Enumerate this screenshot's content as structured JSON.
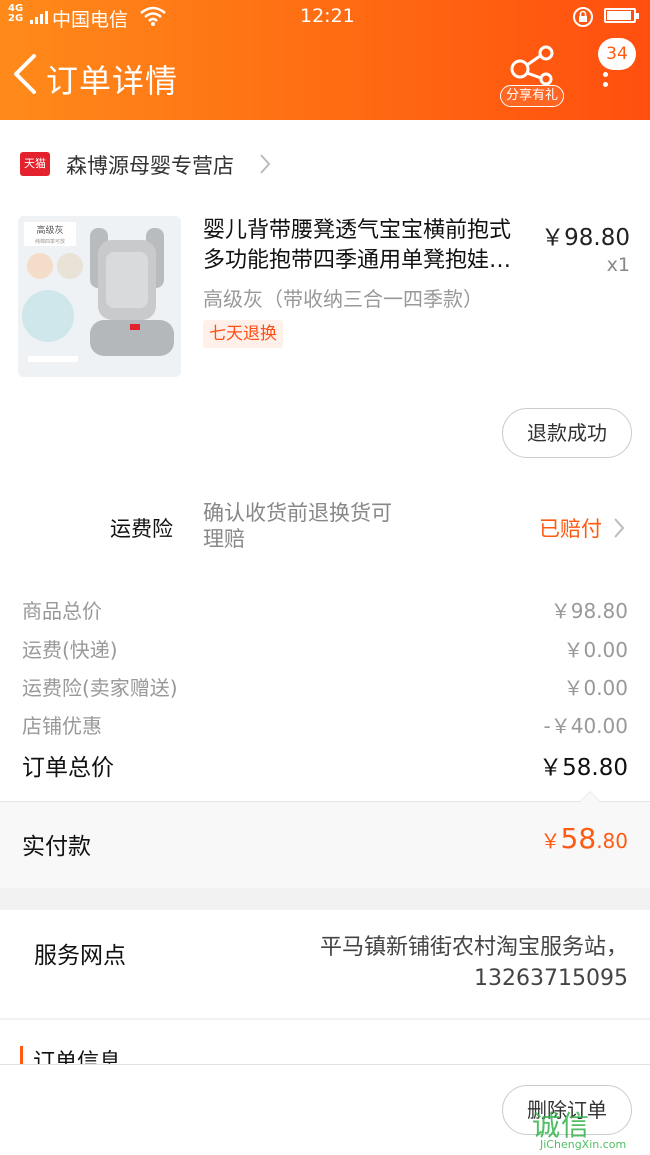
{
  "status_bar": {
    "network": "4G",
    "network2": "2G",
    "carrier": "中国电信",
    "time": "12:21"
  },
  "header": {
    "title": "订单详情",
    "share_label": "分享有礼",
    "message_badge": "34"
  },
  "shop": {
    "platform_badge": "天猫",
    "name": "森博源母婴专营店"
  },
  "product": {
    "title_line1": "婴儿背带腰凳透气宝宝横前抱式",
    "title_line2": "多功能抱带四季通用单凳抱娃…",
    "price": "￥98.80",
    "quantity": "x1",
    "sku": "高级灰（带收纳三合一四季款）",
    "tag": "七天退换",
    "image_caption": "高级灰",
    "image_subcaption": "纯棉四季可放"
  },
  "refund_button": "退款成功",
  "shipping_insurance": {
    "label": "运费险",
    "desc_line1": "确认收货前退换货可",
    "desc_line2": "理赔",
    "status": "已赔付"
  },
  "fees": [
    {
      "label": "商品总价",
      "value": "￥98.80"
    },
    {
      "label": "运费(快递)",
      "value": "￥0.00"
    },
    {
      "label": "运费险(卖家赠送)",
      "value": "￥0.00"
    },
    {
      "label": "店铺优惠",
      "value": "-￥40.00"
    }
  ],
  "order_total": {
    "label": "订单总价",
    "value": "￥58.80"
  },
  "paid": {
    "label": "实付款",
    "currency": "￥",
    "integer": "58",
    "decimal": ".80"
  },
  "service_point": {
    "label": "服务网点",
    "value_line1": "平马镇新铺街农村淘宝服务站，",
    "value_line2": "13263715095"
  },
  "order_info": {
    "title": "订单信息"
  },
  "delete_button": "删除订单",
  "watermark": {
    "main": "诚信",
    "sub": "JiChengXin.com"
  },
  "colors": {
    "accent": "#ff5a12",
    "header_start": "#ff8a1a",
    "header_end": "#ff4f0f",
    "tmall_red": "#e3222d"
  }
}
